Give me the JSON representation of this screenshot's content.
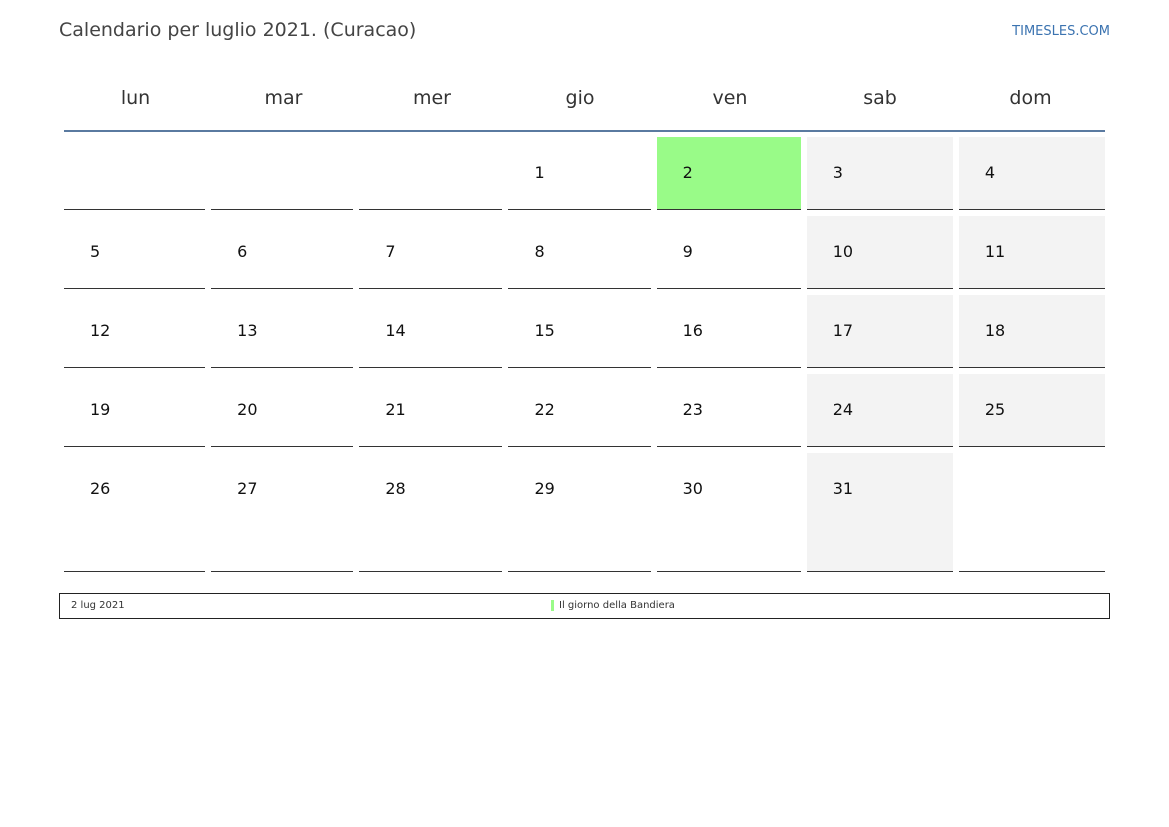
{
  "header": {
    "title": "Calendario per luglio 2021. (Curacao)",
    "brand": "TIMESLES.COM"
  },
  "weekdays": [
    "lun",
    "mar",
    "mer",
    "gio",
    "ven",
    "sab",
    "dom"
  ],
  "weeks": [
    [
      "",
      "",
      "",
      "1",
      "2",
      "3",
      "4"
    ],
    [
      "5",
      "6",
      "7",
      "8",
      "9",
      "10",
      "11"
    ],
    [
      "12",
      "13",
      "14",
      "15",
      "16",
      "17",
      "18"
    ],
    [
      "19",
      "20",
      "21",
      "22",
      "23",
      "24",
      "25"
    ],
    [
      "26",
      "27",
      "28",
      "29",
      "30",
      "31",
      ""
    ]
  ],
  "holidays": [
    "2"
  ],
  "colors": {
    "holiday": "#99fb88",
    "weekend": "#f3f3f3",
    "header_rule": "#5a7aa0",
    "brand": "#3b73b0"
  },
  "legend": {
    "date": "2 lug 2021",
    "name": "Il giorno della Bandiera"
  }
}
